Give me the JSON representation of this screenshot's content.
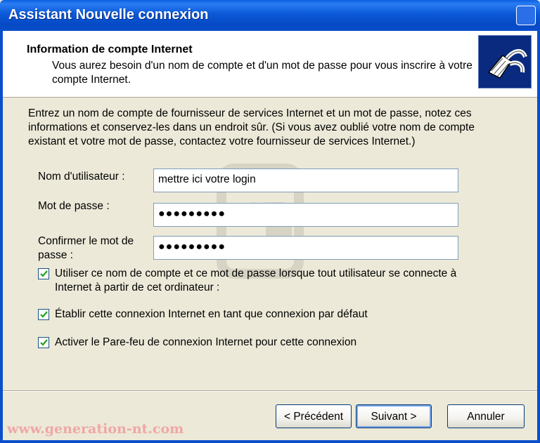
{
  "window": {
    "title": "Assistant Nouvelle connexion"
  },
  "header": {
    "heading": "Information de compte Internet",
    "subtext": "Vous aurez besoin d'un nom de compte et d'un mot de passe pour vous inscrire à votre compte Internet.",
    "icon": "network-cable-icon"
  },
  "intro": "Entrez un nom de compte de fournisseur de services Internet et un mot de passe, notez ces informations et conservez-les dans un endroit sûr. (Si vous avez oublié votre nom de compte existant et votre mot de passe, contactez votre fournisseur de services Internet.)",
  "form": {
    "username_label": "Nom d'utilisateur :",
    "username_value": "mettre ici votre login",
    "password_label": "Mot de passe :",
    "password_value": "●●●●●●●●●",
    "confirm_label": "Confirmer le mot de passe :",
    "confirm_value": "●●●●●●●●●"
  },
  "options": [
    {
      "label": "Utiliser ce nom de compte et ce mot de passe lorsque tout utilisateur se connecte à Internet à partir de cet ordinateur :",
      "checked": true
    },
    {
      "label": "Établir cette connexion Internet en tant que connexion par défaut",
      "checked": true
    },
    {
      "label": "Activer le Pare-feu de connexion Internet pour cette connexion",
      "checked": true
    }
  ],
  "buttons": {
    "back": "< Précédent",
    "next": "Suivant >",
    "cancel": "Annuler"
  },
  "watermark_text": "www.generation-nt.com",
  "colors": {
    "titlebar": "#0a4fcb",
    "dialog_bg": "#ece9d8",
    "check_mark": "#21a121"
  }
}
